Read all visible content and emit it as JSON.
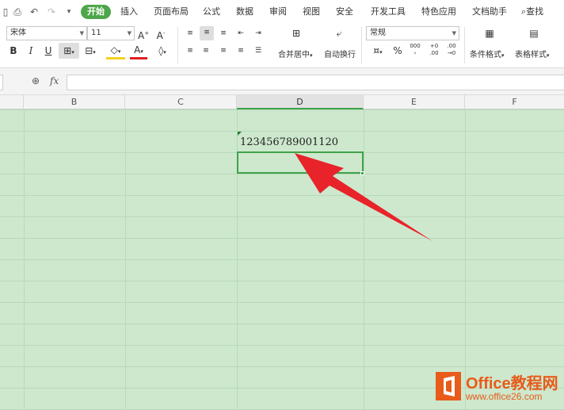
{
  "menubar": {
    "tabs": [
      "开始",
      "插入",
      "页面布局",
      "公式",
      "数据",
      "审阅",
      "视图",
      "安全",
      "开发工具",
      "特色应用",
      "文档助手"
    ],
    "search": "查找"
  },
  "ribbon": {
    "font_name": "宋体",
    "font_size": "11",
    "number_format": "常规",
    "merge_label": "合并居中",
    "wrap_label": "自动换行",
    "cond_format_label": "条件格式",
    "table_style_label": "表格样式",
    "percent": "%",
    "thousands": "000",
    "inc_decimal": "+0\n.00",
    "dec_decimal": ".00\n→0"
  },
  "formula_bar": {
    "fx": "fx",
    "value": ""
  },
  "columns": [
    "B",
    "C",
    "D",
    "E",
    "F"
  ],
  "active_column": "D",
  "cell": {
    "value": "123456789001120"
  },
  "logo": {
    "text": "Office教程网",
    "url": "www.office26.com"
  },
  "colors": {
    "accent": "#4da64a",
    "grid": "#cde8cd",
    "selection": "#3fa24a",
    "arrow": "#e8232a",
    "logo": "#e85b1a"
  }
}
